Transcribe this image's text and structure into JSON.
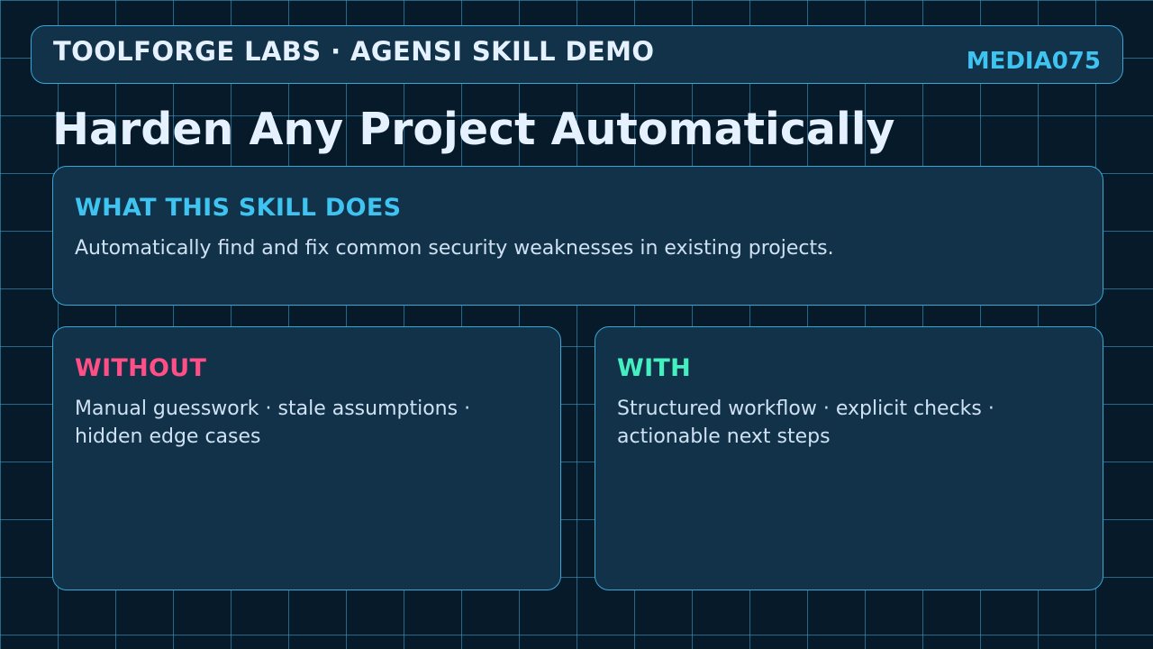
{
  "header": {
    "brand": "TOOLFORGE LABS · AGENSI SKILL DEMO",
    "code": "MEDIA075"
  },
  "title": "Harden Any Project Automatically",
  "what": {
    "heading": "WHAT THIS SKILL DOES",
    "body": "Automatically find and fix common security weaknesses in existing projects."
  },
  "without": {
    "heading": "WITHOUT",
    "body": "Manual guesswork · stale assumptions · hidden edge cases"
  },
  "with": {
    "heading": "WITH",
    "body": "Structured workflow · explicit checks · actionable next steps"
  },
  "colors": {
    "background": "#061a2a",
    "panel": "#113248",
    "border": "#3aa6d6",
    "accent_cyan": "#3fc4f2",
    "without_pink": "#ff4f86",
    "with_green": "#45f0c0",
    "text": "#e6f1ff"
  }
}
